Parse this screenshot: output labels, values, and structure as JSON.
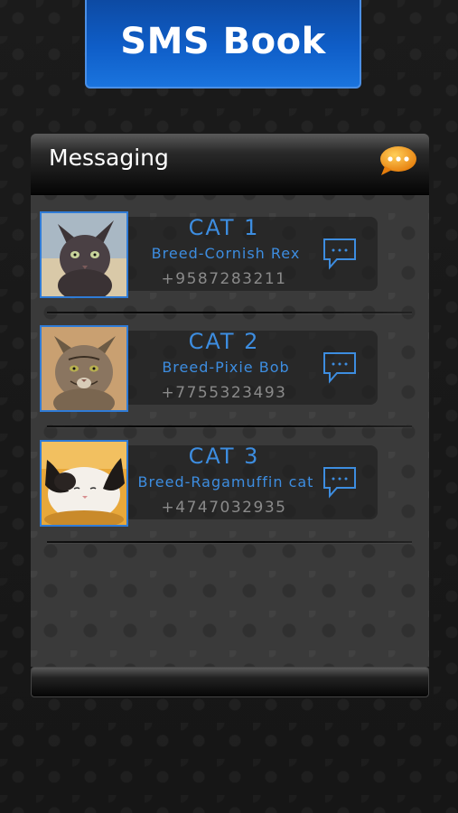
{
  "app": {
    "title": "SMS Book"
  },
  "panel": {
    "header": "Messaging"
  },
  "contacts": [
    {
      "name": "CAT  1",
      "breed": "Breed-Cornish Rex",
      "phone": "+9587283211"
    },
    {
      "name": "CAT  2",
      "breed": "Breed-Pixie Bob",
      "phone": "+7755323493"
    },
    {
      "name": "CAT  3",
      "breed": "Breed-Ragamuffin cat",
      "phone": "+4747032935"
    }
  ],
  "colors": {
    "accent": "#3d8de0",
    "title_bg": "#0f5ec8",
    "icon_orange": "#f39c12"
  }
}
